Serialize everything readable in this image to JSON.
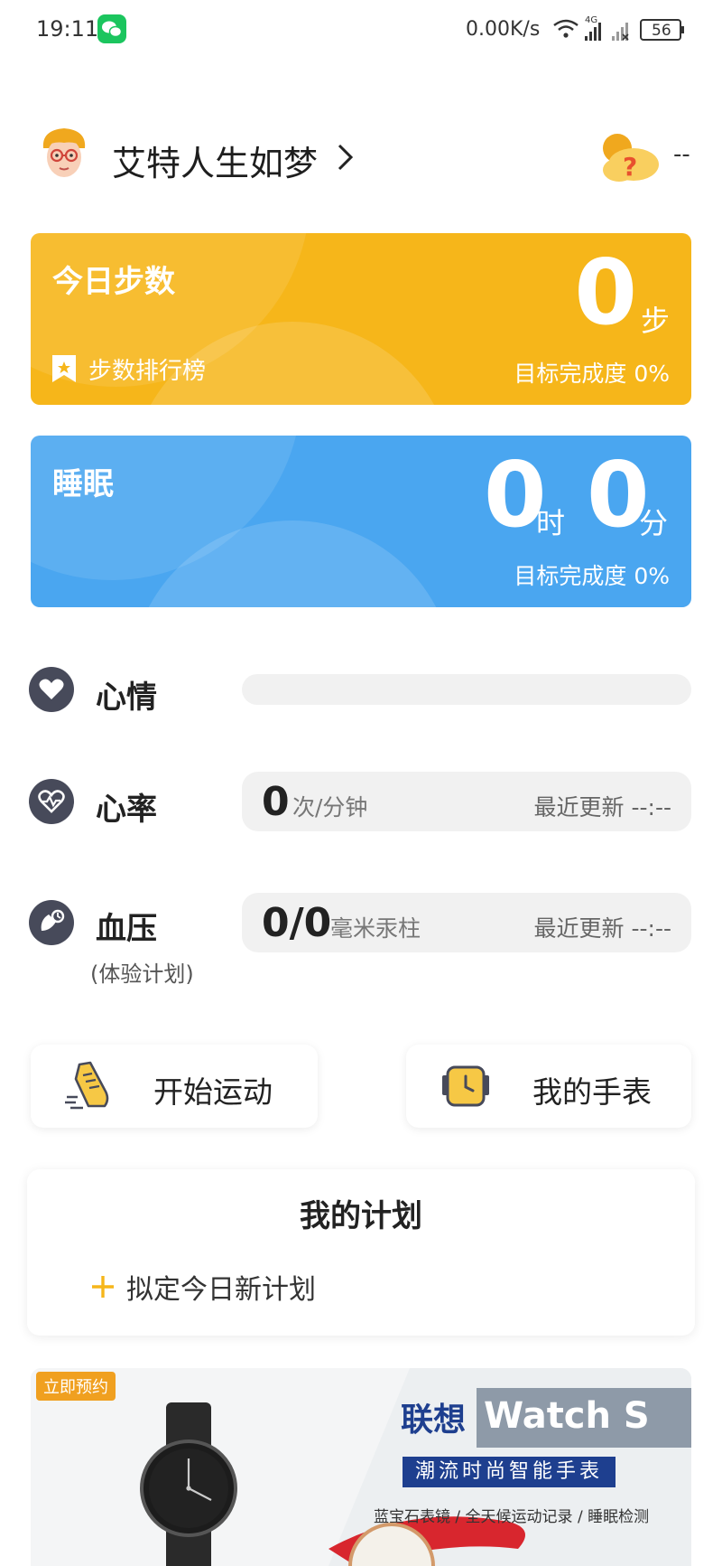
{
  "status_bar": {
    "time": "19:11",
    "network_speed": "0.00K/s",
    "network_type": "4G",
    "battery": "56"
  },
  "header": {
    "username": "艾特人生如梦",
    "weather_value": "--"
  },
  "steps_card": {
    "title": "今日步数",
    "value": "0",
    "unit": "步",
    "ranking_label": "步数排行榜",
    "goal_text": "目标完成度 0%",
    "color": "#f6b61a"
  },
  "sleep_card": {
    "title": "睡眠",
    "hours": "0",
    "hours_unit": "时",
    "minutes": "0",
    "minutes_unit": "分",
    "goal_text": "目标完成度 0%",
    "color": "#4aa6f0"
  },
  "mood": {
    "label": "心情"
  },
  "heart_rate": {
    "label": "心率",
    "value": "0",
    "unit": "次/分钟",
    "update_label": "最近更新  --:--"
  },
  "blood_pressure": {
    "label": "血压",
    "sublabel": "(体验计划)",
    "value": "0/0",
    "unit": "毫米汞柱",
    "update_label": "最近更新  --:--"
  },
  "actions": {
    "start_exercise": "开始运动",
    "my_watch": "我的手表"
  },
  "plan": {
    "title": "我的计划",
    "add_label": "拟定今日新计划"
  },
  "banner": {
    "tag": "立即预约",
    "brand": "联想",
    "product": "Watch S",
    "slogan": "潮流时尚智能手表",
    "features": "蓝宝石表镜 / 全天候运动记录 / 睡眠检测"
  },
  "icons": {
    "avatar": "avatar-icon",
    "weather": "weather-unknown-icon",
    "ranking": "bookmark-star-icon",
    "mood": "heart-icon",
    "heart_rate": "heart-pulse-icon",
    "blood_pressure": "blood-pressure-icon",
    "exercise": "running-shoe-icon",
    "watch": "watch-icon",
    "plus": "plus-icon"
  },
  "colors": {
    "accent_yellow": "#f6b61a",
    "accent_blue": "#4aa6f0",
    "icon_dark": "#474a5a"
  }
}
